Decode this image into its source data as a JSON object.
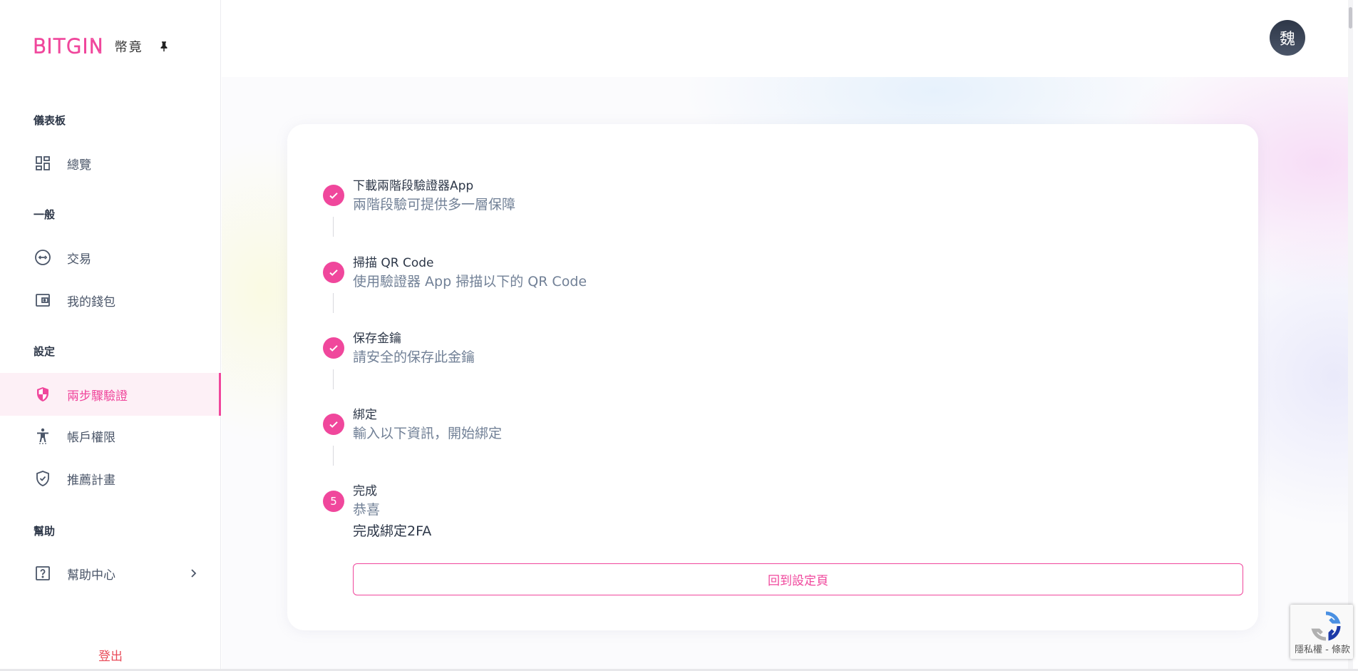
{
  "brand": {
    "logo": "BITGIN",
    "sub": "幣竟"
  },
  "colors": {
    "accent": "#f0479c",
    "logout": "#e94b59"
  },
  "sidebar": {
    "sections": [
      {
        "title": "儀表板"
      },
      {
        "title": "一般"
      },
      {
        "title": "設定"
      },
      {
        "title": "幫助"
      }
    ],
    "items": [
      {
        "label": "總覽",
        "icon": "dashboard-icon"
      },
      {
        "label": "交易",
        "icon": "exchange-icon"
      },
      {
        "label": "我的錢包",
        "icon": "wallet-icon"
      },
      {
        "label": "兩步驟驗證",
        "icon": "shield-icon",
        "active": true
      },
      {
        "label": "帳戶權限",
        "icon": "accessibility-icon"
      },
      {
        "label": "推薦計畫",
        "icon": "verified-shield-icon"
      },
      {
        "label": "幫助中心",
        "icon": "help-icon"
      }
    ],
    "logout": "登出"
  },
  "header": {
    "avatar": "魏"
  },
  "steps": [
    {
      "title": "下載兩階段驗證器App",
      "desc": "兩階段驗可提供多一層保障",
      "status": "done"
    },
    {
      "title": "掃描 QR Code",
      "desc": "使用驗證器 App 掃描以下的 QR Code",
      "status": "done"
    },
    {
      "title": "保存金鑰",
      "desc": "請安全的保存此金鑰",
      "status": "done"
    },
    {
      "title": "綁定",
      "desc": "輸入以下資訊，開始綁定",
      "status": "done"
    },
    {
      "title": "完成",
      "desc": "恭喜",
      "status": "current",
      "number": "5"
    }
  ],
  "done_text": "完成綁定2FA",
  "back_button": "回到設定頁",
  "recaptcha": {
    "text": "隱私權 - 條款"
  }
}
